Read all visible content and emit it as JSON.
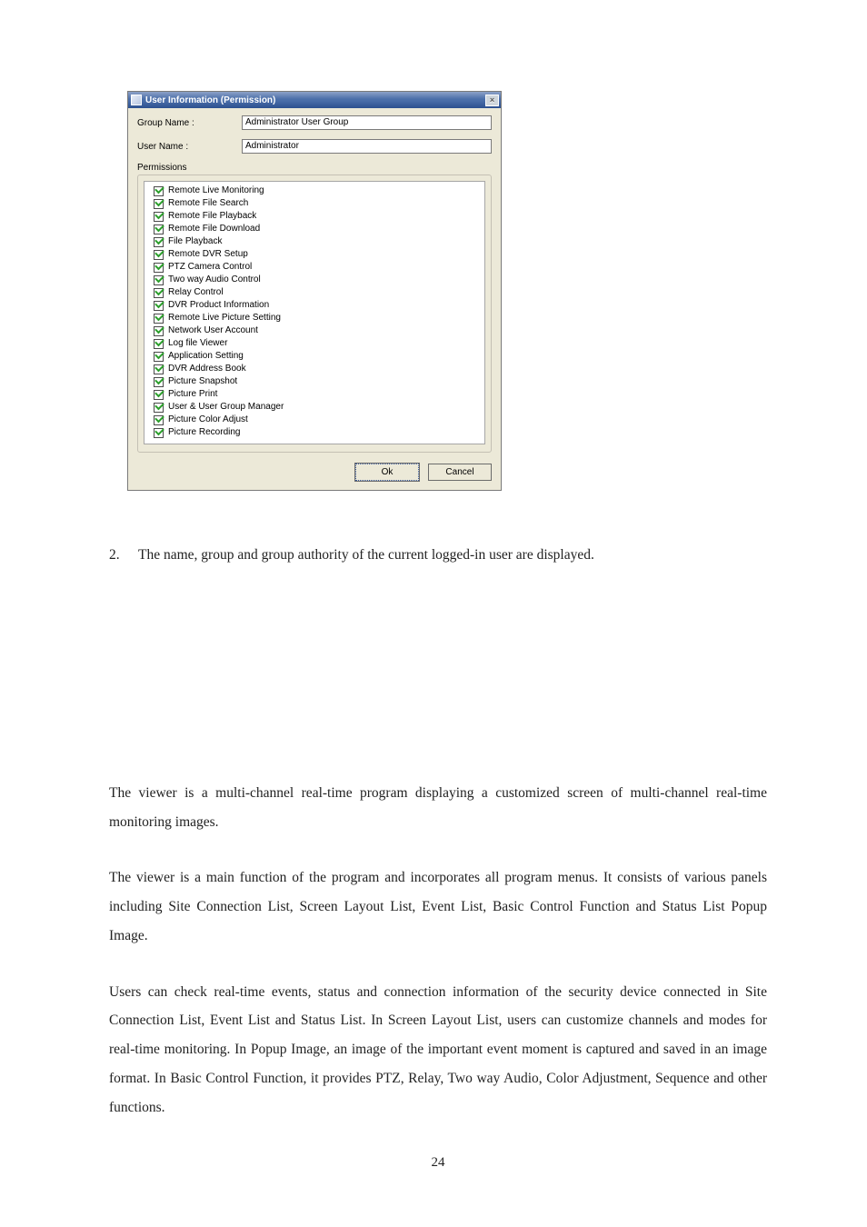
{
  "dialog": {
    "title": "User Information (Permission)",
    "group_name_label": "Group Name :",
    "group_name_value": "Administrator User Group",
    "user_name_label": "User Name :",
    "user_name_value": "Administrator",
    "perm_caption": "Permissions",
    "permissions": [
      "Remote Live Monitoring",
      "Remote File Search",
      "Remote File Playback",
      "Remote File Download",
      "File Playback",
      "Remote DVR Setup",
      "PTZ Camera Control",
      "Two way Audio Control",
      "Relay Control",
      "DVR Product Information",
      "Remote Live Picture Setting",
      "Network User Account",
      "Log file Viewer",
      "Application Setting",
      "DVR Address Book",
      "Picture Snapshot",
      "Picture Print",
      "User & User Group Manager",
      "Picture Color Adjust",
      "Picture Recording"
    ],
    "ok": "Ok",
    "cancel": "Cancel"
  },
  "doc": {
    "list_num": "2.",
    "list_text": "The name, group and group authority of the current logged-in user are displayed.",
    "p1": "The viewer is a multi-channel real-time program displaying a customized screen of multi-channel real-time monitoring images.",
    "p2": "The viewer is a main function of the program and incorporates all program menus. It consists of various panels including Site Connection List, Screen Layout List, Event List, Basic Control Function and Status List Popup Image.",
    "p3": "Users can check real-time events, status and connection information of the security device connected in Site Connection List, Event List and Status List. In Screen Layout List, users can customize channels and modes for real-time monitoring. In Popup Image, an image of the important event moment is captured and saved in an image format. In Basic Control Function, it provides PTZ, Relay, Two way Audio, Color Adjustment, Sequence and other functions.",
    "page_number": "24"
  }
}
